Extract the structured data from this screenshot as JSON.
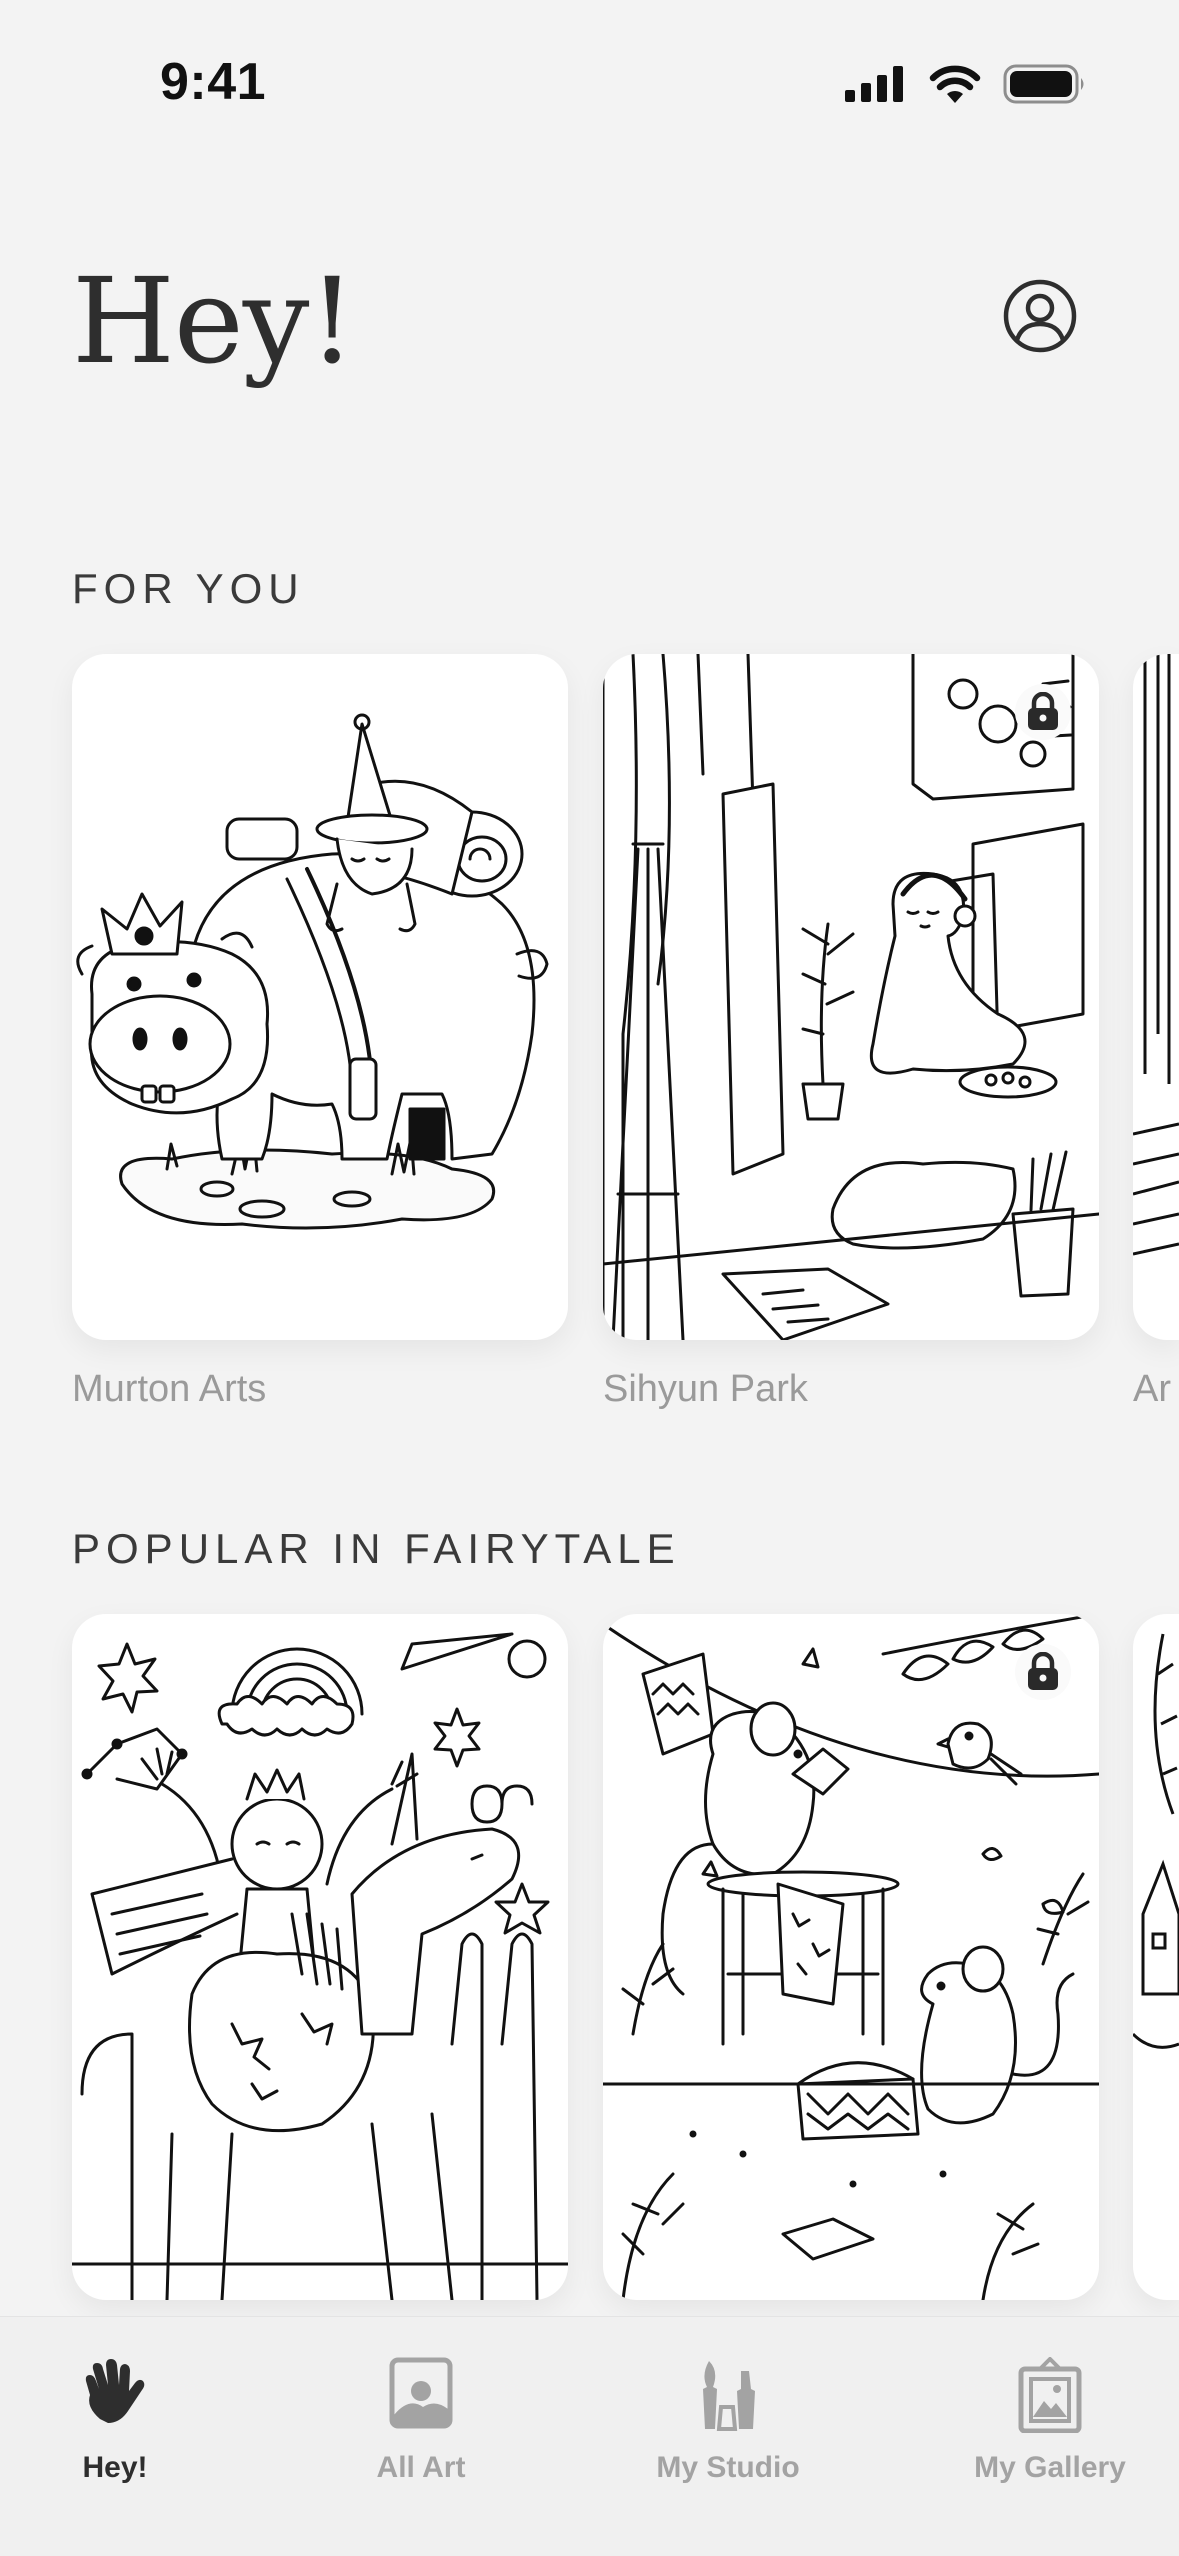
{
  "status_bar": {
    "time": "9:41",
    "icons": [
      "cellular-signal-icon",
      "wifi-icon",
      "battery-icon"
    ]
  },
  "header": {
    "greeting": "Hey!",
    "profile_icon": "user-circle-icon"
  },
  "sections": [
    {
      "title": "FOR YOU",
      "cards": [
        {
          "artist": "Murton Arts",
          "locked": false,
          "art": "hippo-with-crown-and-gnome"
        },
        {
          "artist": "Sihyun Park",
          "locked": true,
          "art": "girl-painting-in-studio"
        },
        {
          "artist": "Ar",
          "locked": false,
          "art": "partial-card"
        }
      ]
    },
    {
      "title": "POPULAR IN FAIRYTALE",
      "cards": [
        {
          "artist": "",
          "locked": false,
          "art": "princess-riding-unicorn"
        },
        {
          "artist": "",
          "locked": true,
          "art": "mice-hanging-laundry"
        },
        {
          "artist": "",
          "locked": false,
          "art": "partial-card"
        }
      ]
    }
  ],
  "tab_bar": {
    "active": "Hey!",
    "tabs": [
      {
        "label": "Hey!",
        "icon": "waving-hand-icon"
      },
      {
        "label": "All Art",
        "icon": "picture-icon"
      },
      {
        "label": "My Studio",
        "icon": "brushes-icon"
      },
      {
        "label": "My Gallery",
        "icon": "framed-picture-icon"
      }
    ]
  },
  "colors": {
    "background": "#f3f3f3",
    "card": "#ffffff",
    "text_primary": "#2e2e2e",
    "text_secondary": "#9a9a9a",
    "tab_inactive": "#a3a3a3"
  }
}
